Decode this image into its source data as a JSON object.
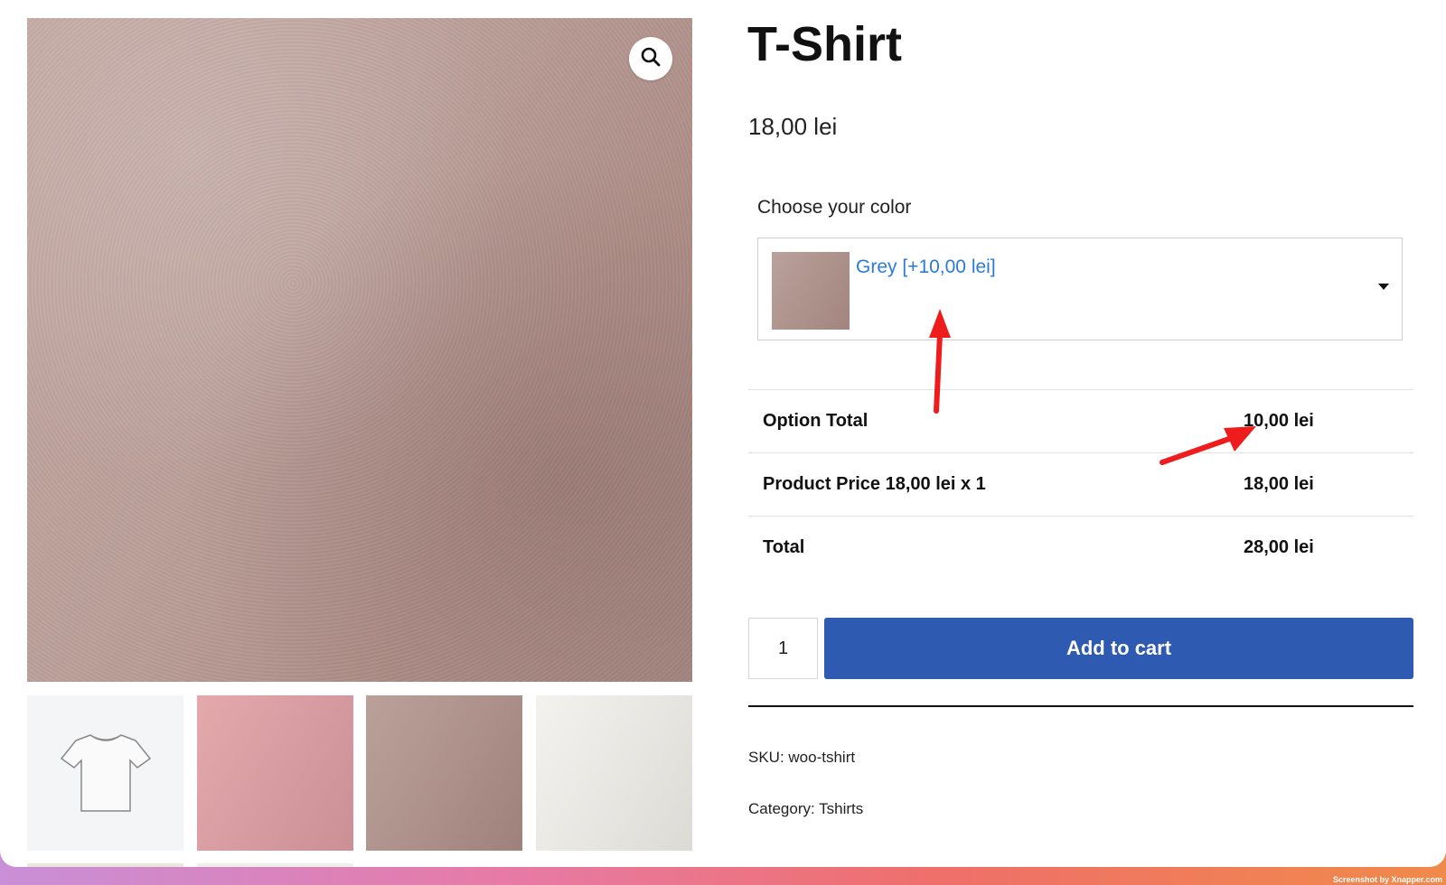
{
  "product": {
    "title": "T-Shirt",
    "price": "18,00 lei"
  },
  "gallery": {
    "zoom_icon": "search-icon",
    "thumbnails": [
      "tshirt-outline",
      "pink",
      "grey",
      "white"
    ]
  },
  "options": {
    "color_label": "Choose your color",
    "selected_value": "Grey [+10,00 lei]",
    "dropdown_icon": "caret-down-icon"
  },
  "totals": {
    "rows": [
      {
        "label": "Option Total",
        "value": "10,00 lei"
      },
      {
        "label": "Product Price 18,00 lei x 1",
        "value": "18,00 lei"
      },
      {
        "label": "Total",
        "value": "28,00 lei"
      }
    ]
  },
  "cart": {
    "quantity": "1",
    "add_to_cart_label": "Add to cart"
  },
  "meta": {
    "sku": "SKU: woo-tshirt",
    "category": "Category: Tshirts"
  },
  "footer": {
    "credit": "Screenshot by Xnapper.com"
  },
  "colors": {
    "accent": "#2f5ab1",
    "link": "#2b7bd6",
    "annotation_arrow": "#ee1c1c"
  }
}
